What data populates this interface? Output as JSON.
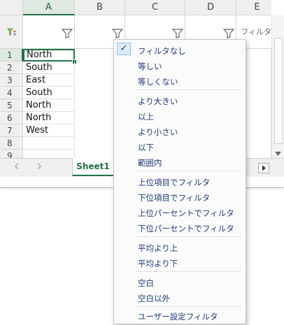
{
  "columns": [
    "A",
    "B",
    "C",
    "D",
    "E"
  ],
  "filter_header_text": "フィルタ…",
  "rows": [
    {
      "num": "1",
      "a": "North"
    },
    {
      "num": "2",
      "a": "South"
    },
    {
      "num": "3",
      "a": "East"
    },
    {
      "num": "4",
      "a": "South"
    },
    {
      "num": "5",
      "a": "North"
    },
    {
      "num": "6",
      "a": "North"
    },
    {
      "num": "7",
      "a": "West"
    },
    {
      "num": "8",
      "a": ""
    },
    {
      "num": "9",
      "a": ""
    }
  ],
  "sheet_tab": "Sheet1",
  "menu": {
    "checked_mark": "✓",
    "items": [
      "フィルタなし",
      "等しい",
      "等しくない",
      "より大きい",
      "以上",
      "より小さい",
      "以下",
      "範囲内",
      "上位項目でフィルタ",
      "下位項目でフィルタ",
      "上位パーセントでフィルタ",
      "下位パーセントでフィルタ",
      "平均より上",
      "平均より下",
      "空白",
      "空白以外",
      "ユーザー設定フィルタ"
    ]
  },
  "icons": {
    "funnel": "filter-funnel-icon",
    "sort_filter": "sort-filter-icon",
    "checkmark": "checkmark-icon"
  },
  "colors": {
    "accent": "#217346",
    "menu_text": "#1f3a7a"
  }
}
